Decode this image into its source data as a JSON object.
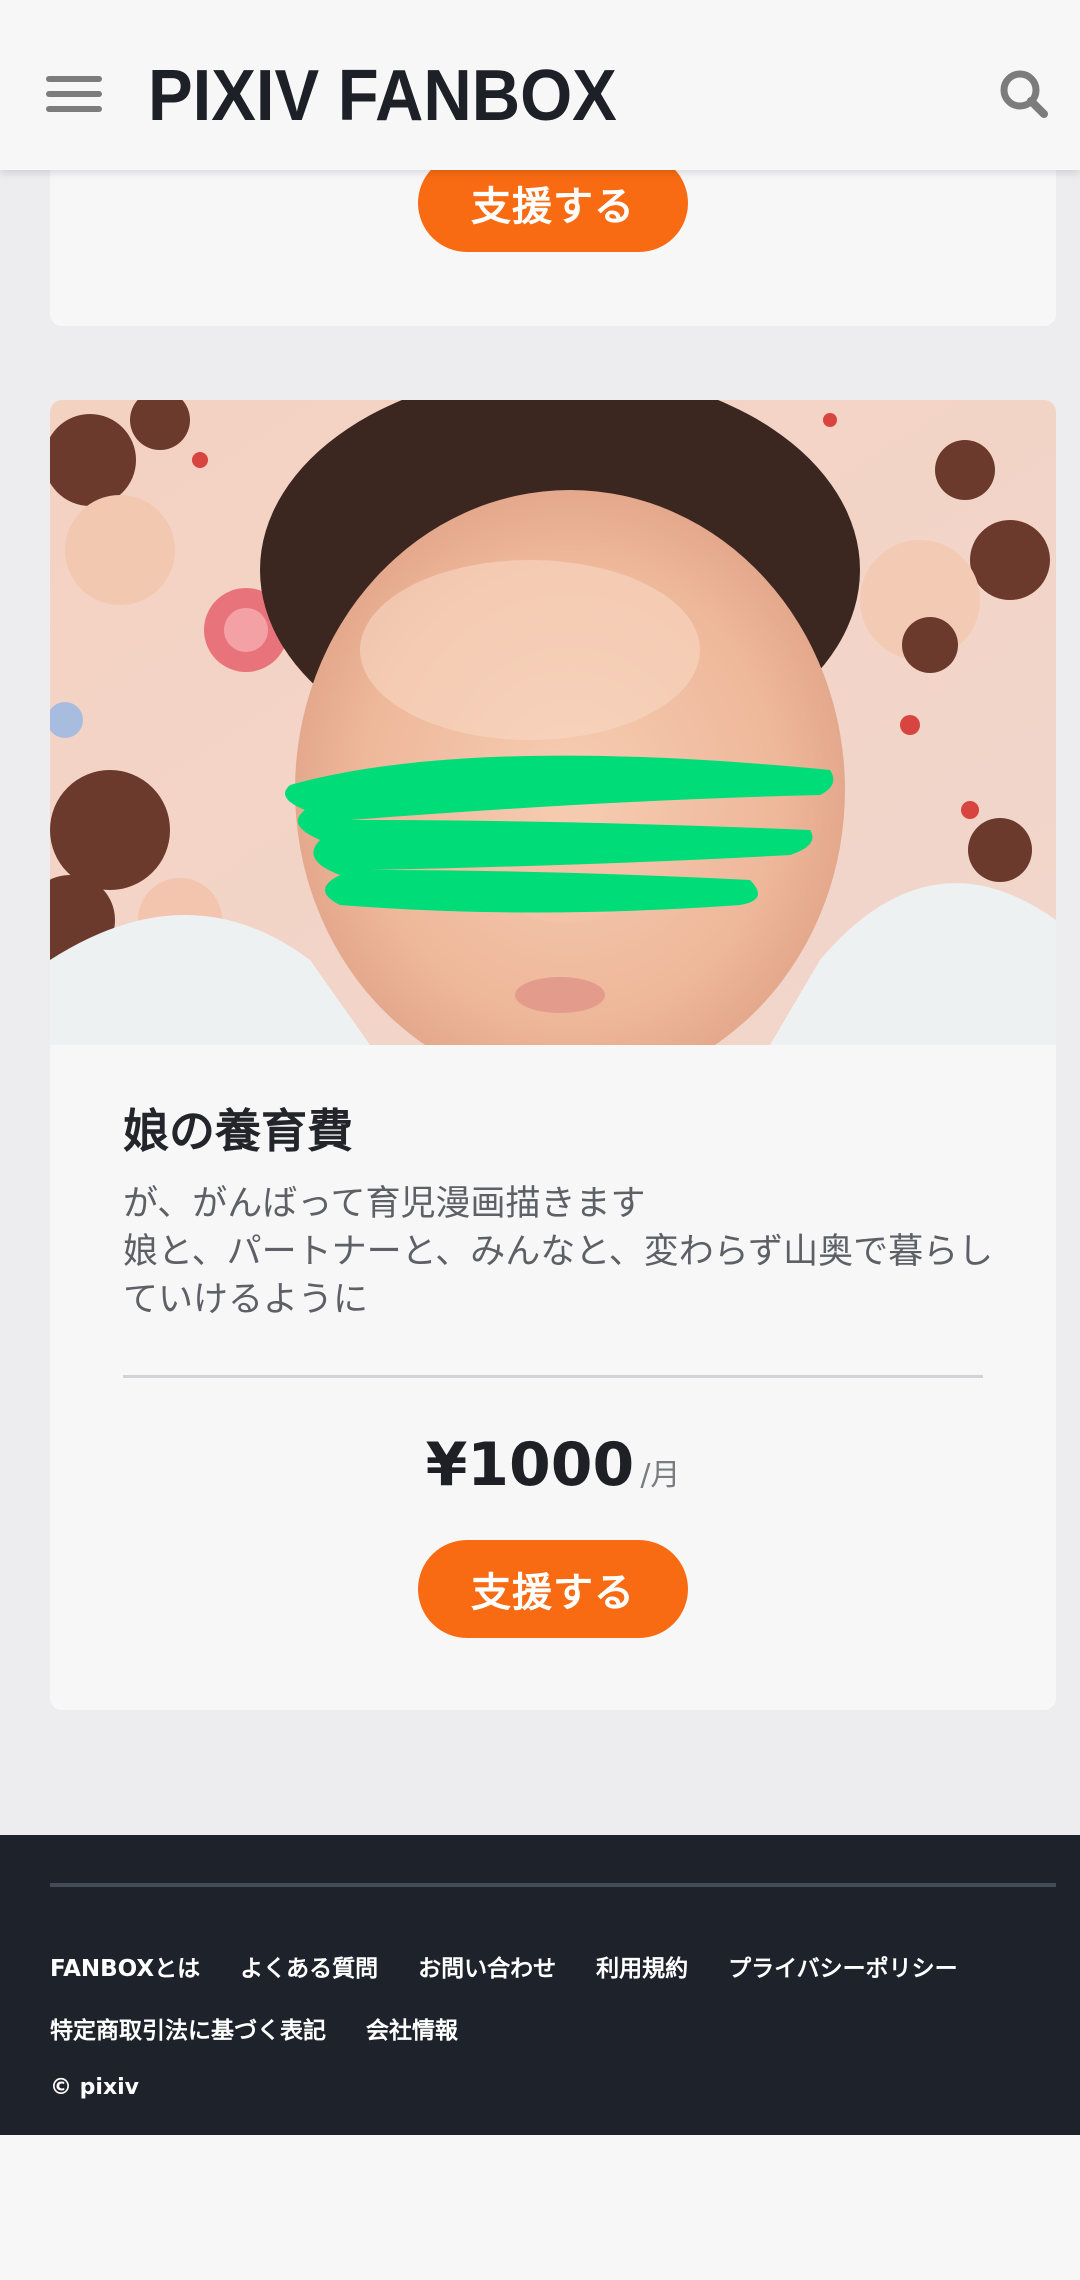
{
  "header": {
    "logo": "PIXIV FANBOX",
    "menu_icon": "hamburger-menu-icon",
    "search_icon": "search-icon"
  },
  "plans": [
    {
      "button_label": "支援する"
    },
    {
      "image": "baby-photo",
      "title": "娘の養育費",
      "description": [
        "が、がんばって育児漫画描きます",
        "娘と、パートナーと、みんなと、変わらず山奥で暮らしていけるように"
      ],
      "price": "¥1000",
      "unit": "/月",
      "button_label": "支援する"
    }
  ],
  "footer": {
    "links_row1": [
      "FANBOXとは",
      "よくある質問",
      "お問い合わせ",
      "利用規約",
      "プライバシーポリシー"
    ],
    "links_row2": [
      "特定商取引法に基づく表記",
      "会社情報"
    ],
    "copyright": "© pixiv"
  },
  "colors": {
    "accent": "#f96b12",
    "footer_bg": "#1e222b",
    "page_bg": "#ededef",
    "card_bg": "#f7f7f8"
  }
}
